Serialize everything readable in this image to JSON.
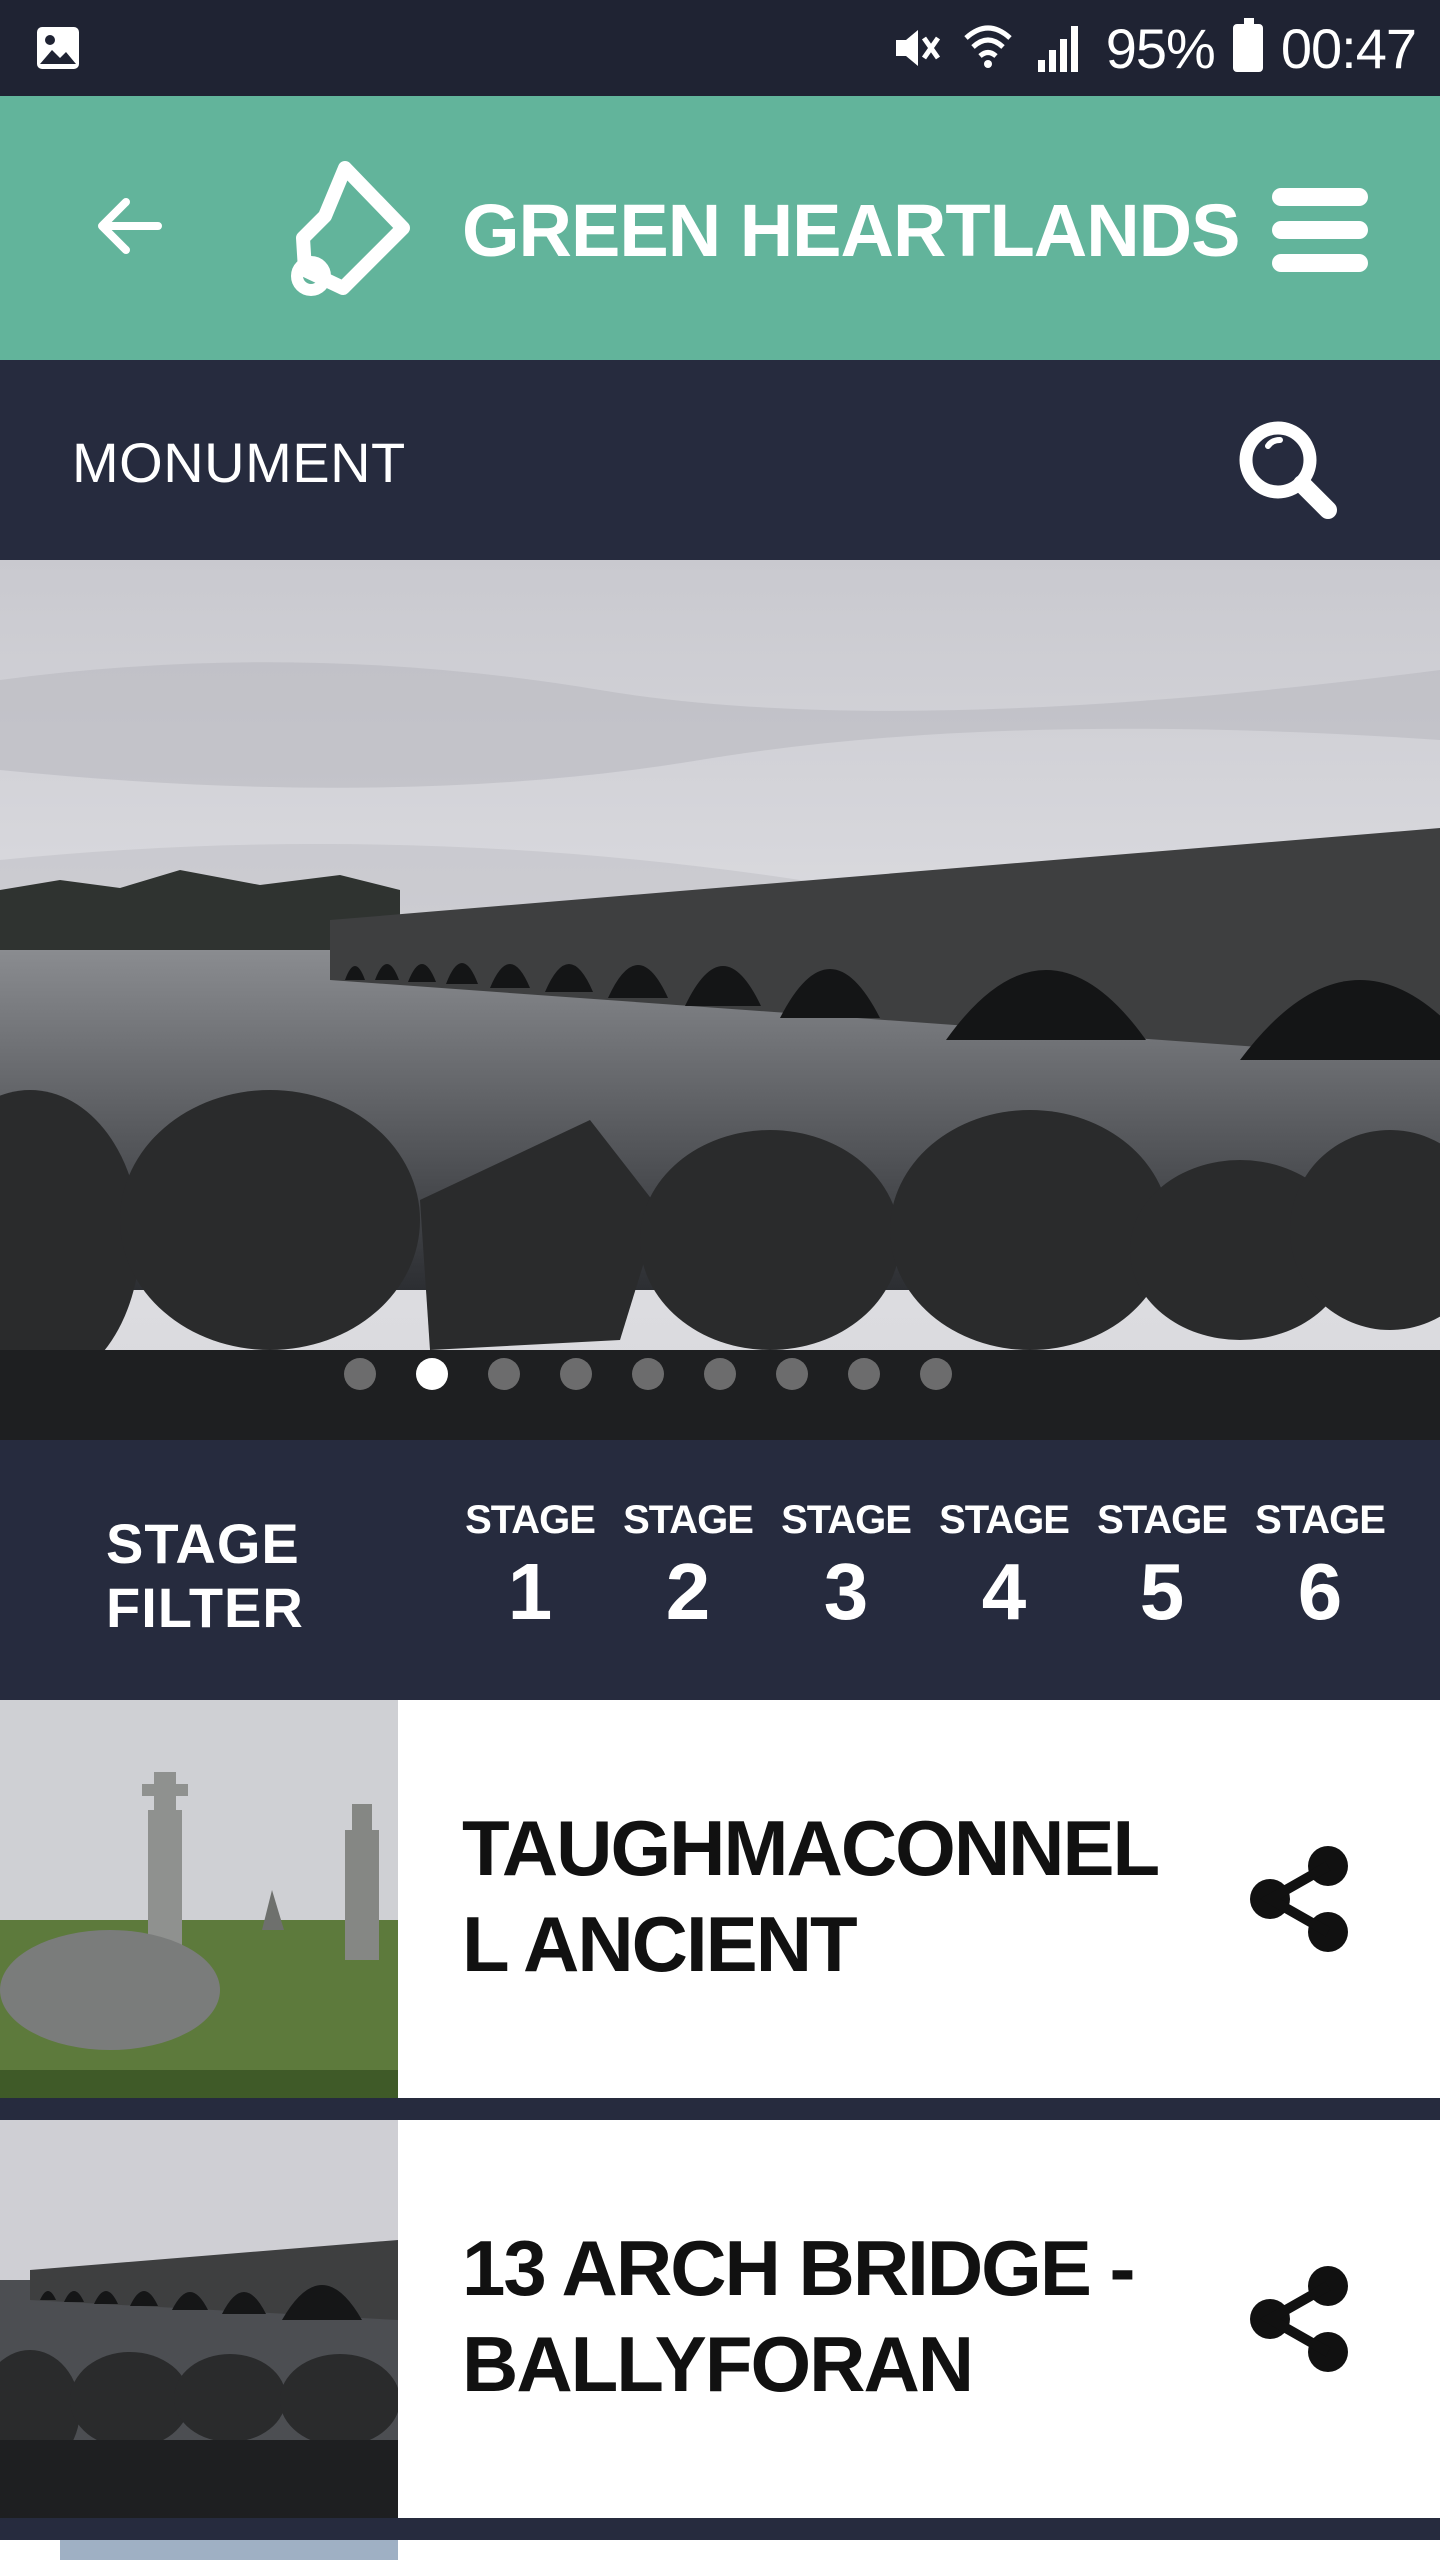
{
  "status_bar": {
    "battery_percent": "95%",
    "time": "00:47",
    "icons": [
      "image-notification-icon",
      "mute-icon",
      "wifi-icon",
      "signal-icon",
      "battery-icon"
    ]
  },
  "app_bar": {
    "title": "GREEN HEARTLANDS",
    "back_icon": "arrow-left-icon",
    "menu_icon": "hamburger-menu-icon",
    "accent_color": "#62b49b"
  },
  "category_bar": {
    "title": "MONUMENT",
    "search_icon": "search-icon"
  },
  "hero": {
    "slide_count": 9,
    "active_slide": 2
  },
  "stage_filter": {
    "label_line1": "STAGE",
    "label_line2": "FILTER",
    "stages": [
      {
        "word": "STAGE",
        "number": "1"
      },
      {
        "word": "STAGE",
        "number": "2"
      },
      {
        "word": "STAGE",
        "number": "3"
      },
      {
        "word": "STAGE",
        "number": "4"
      },
      {
        "word": "STAGE",
        "number": "5"
      },
      {
        "word": "STAGE",
        "number": "6"
      }
    ]
  },
  "items": [
    {
      "title_line1": "TAUGHMACONNEL",
      "title_line2": "L ANCIENT",
      "share_icon": "share-icon"
    },
    {
      "title_line1": "13 ARCH BRIDGE -",
      "title_line2": "BALLYFORAN",
      "share_icon": "share-icon"
    }
  ],
  "colors": {
    "dark_navy": "#262b3e",
    "status_bar": "#1f2333",
    "teal": "#62b49b"
  }
}
